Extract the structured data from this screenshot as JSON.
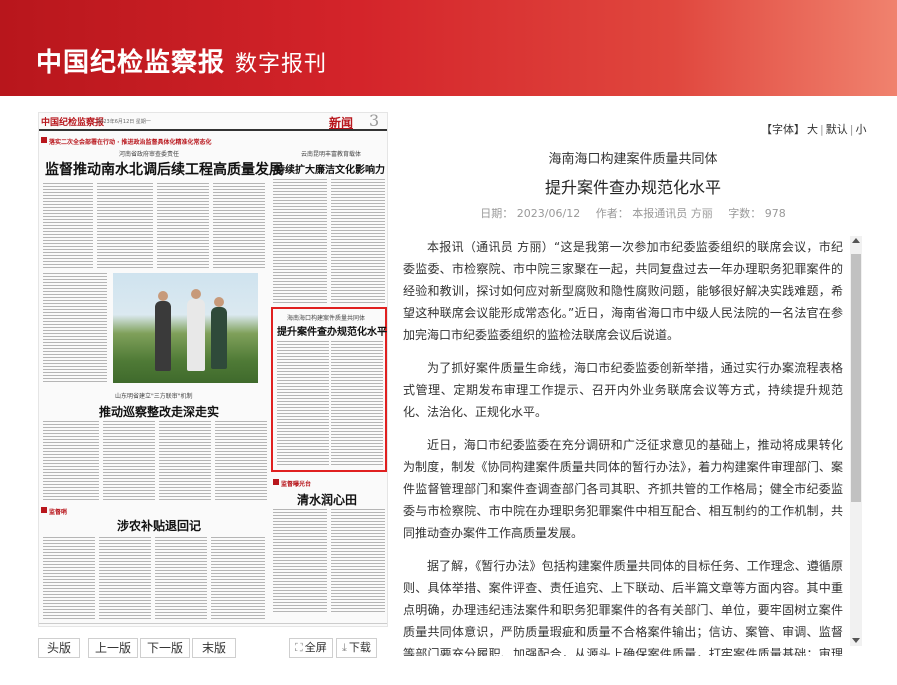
{
  "header": {
    "brand": "中国纪检监察报",
    "subtitle": "数字报刊"
  },
  "newspaper": {
    "masthead": "中国纪检监察报",
    "date_line": "2023年6月12日 星期一",
    "section": "新闻",
    "page_number": "3",
    "tag_top": "落实二次全会部署在行动 · 推进政治监督具体化精准化常态化",
    "kicker_left": "河南省政府审查委责任",
    "headline_main": "监督推动南水北调后续工程高质量发展",
    "kicker_right": "云南昆明丰富教育载体",
    "headline_right": "持续扩大廉洁文化影响力",
    "kicker_highlight": "海南海口构建案件质量共同体",
    "headline_highlight": "提升案件查办规范化水平",
    "kicker_mid": "山东明省建立\"三方联审\"机制",
    "headline_mid": "推动巡察整改走深走实",
    "tag_right": "监督曝光台",
    "headline_right_bottom": "清水润心田",
    "tag_left": "监督哨",
    "headline_bottom": "涉农补贴退回记"
  },
  "nav": {
    "first": "头版",
    "prev": "上一版",
    "next": "下一版",
    "last": "末版",
    "fullscreen": "全屏",
    "download": "下载"
  },
  "font_size": {
    "label": "【字体】",
    "large": "大",
    "default": "默认",
    "small": "小"
  },
  "article": {
    "subtitle": "海南海口构建案件质量共同体",
    "title": "提升案件查办规范化水平",
    "date": "日期： 2023/06/12",
    "author": "作者： 本报通讯员 方丽",
    "wordcount": "字数： 978",
    "paragraphs": [
      "本报讯（通讯员 方丽）“这是我第一次参加市纪委监委组织的联席会议，市纪委监委、市检察院、市中院三家聚在一起，共同复盘过去一年办理职务犯罪案件的经验和教训，探讨如何应对新型腐败和隐性腐败问题，能够很好解决实践难题，希望这种联席会议能形成常态化。”近日，海南省海口市中级人民法院的一名法官在参加完海口市纪委监委组织的监检法联席会议后说道。",
      "为了抓好案件质量生命线，海口市纪委监委创新举措，通过实行办案流程表格式管理、定期发布审理工作提示、召开内外业务联席会议等方式，持续提升规范化、法治化、正规化水平。",
      "近日，海口市纪委监委在充分调研和广泛征求意见的基础上，推动将成果转化为制度，制发《协同构建案件质量共同体的暂行办法》，着力构建案件审理部门、案件监督管理部门和案件查调查部门各司其职、齐抓共管的工作格局；健全市纪委监委与市检察院、市中院在办理职务犯罪案件中相互配合、相互制约的工作机制，共同推动查办案件工作高质量发展。",
      "据了解，《暂行办法》包括构建案件质量共同体的目标任务、工作理念、遵循原则、具体举措、案件评查、责任追究、上下联动、后半篇文章等方面内容。其中重点明确，办理违纪违法案件和职务犯罪案件的各有关部门、单位，要牢固树立案件质量共同体意识，严防质量瑕疵和质量不合格案件输出；信访、案管、审调、监督等部门要充分履职、加强配合，从源头上确保案件质量，打牢案件质量基础；审理部门主动增强服务意识，发挥协助引导作用，为审查调查提供专业支持，做到严格审核把关和巩固审查调查成果相统一。"
    ]
  }
}
